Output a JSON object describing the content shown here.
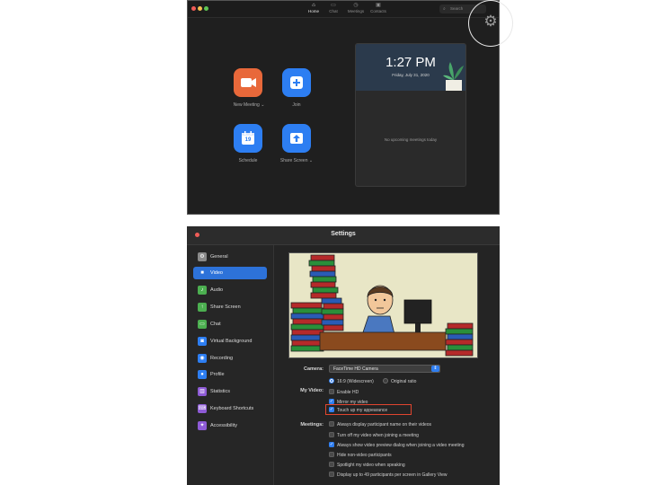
{
  "home": {
    "tabs": [
      {
        "label": "Home",
        "icon": "house-icon"
      },
      {
        "label": "Chat",
        "icon": "chat-icon"
      },
      {
        "label": "Meetings",
        "icon": "clock-icon"
      },
      {
        "label": "Contacts",
        "icon": "contacts-icon"
      }
    ],
    "search_label": "Search",
    "actions": [
      {
        "label": "New Meeting",
        "color": "#e8683a",
        "icon": "video-camera-icon"
      },
      {
        "label": "Join",
        "color": "#2d7ef2",
        "icon": "plus-icon"
      },
      {
        "label": "Schedule",
        "color": "#2d7ef2",
        "icon": "calendar-icon",
        "calendar_day": "19"
      },
      {
        "label": "Share Screen",
        "color": "#2d7ef2",
        "icon": "share-up-arrow-icon"
      }
    ],
    "meeting_panel": {
      "time": "1:27 PM",
      "date": "Friday, July 31, 2020",
      "empty_text": "No upcoming meetings today"
    }
  },
  "settings": {
    "title": "Settings",
    "sidebar": [
      {
        "label": "General",
        "icon": "gear-icon",
        "color": "#8a8a8a"
      },
      {
        "label": "Video",
        "icon": "video-camera-icon",
        "color": "#2d72d9",
        "selected": true
      },
      {
        "label": "Audio",
        "icon": "headphones-icon",
        "color": "#4caf50"
      },
      {
        "label": "Share Screen",
        "icon": "share-screen-icon",
        "color": "#4caf50"
      },
      {
        "label": "Chat",
        "icon": "chat-bubble-icon",
        "color": "#4caf50"
      },
      {
        "label": "Virtual Background",
        "icon": "person-background-icon",
        "color": "#2d7ef2"
      },
      {
        "label": "Recording",
        "icon": "record-icon",
        "color": "#2d7ef2"
      },
      {
        "label": "Profile",
        "icon": "profile-icon",
        "color": "#2d7ef2"
      },
      {
        "label": "Statistics",
        "icon": "stats-icon",
        "color": "#8e5bd6"
      },
      {
        "label": "Keyboard Shortcuts",
        "icon": "keyboard-icon",
        "color": "#8e5bd6"
      },
      {
        "label": "Accessibility",
        "icon": "accessibility-icon",
        "color": "#8e5bd6"
      }
    ],
    "camera": {
      "label": "Camera:",
      "value": "FaceTime HD Camera"
    },
    "my_video": {
      "label": "My Video:",
      "ratio_options": [
        {
          "label": "16:9 (Widescreen)",
          "selected": true
        },
        {
          "label": "Original ratio",
          "selected": false
        }
      ],
      "checks": [
        {
          "label": "Enable HD",
          "checked": false
        },
        {
          "label": "Mirror my video",
          "checked": true
        },
        {
          "label": "Touch up my appearance",
          "checked": true
        }
      ]
    },
    "meetings": {
      "label": "Meetings:",
      "checks": [
        {
          "label": "Always display participant name on their videos",
          "checked": false
        },
        {
          "label": "Turn off my video when joining a meeting",
          "checked": false
        },
        {
          "label": "Always show video preview dialog when joining a video meeting",
          "checked": true
        },
        {
          "label": "Hide non-video participants",
          "checked": false
        },
        {
          "label": "Spotlight my video when speaking",
          "checked": false
        },
        {
          "label": "Display up to 49 participants per screen in Gallery View",
          "checked": false
        }
      ]
    }
  }
}
